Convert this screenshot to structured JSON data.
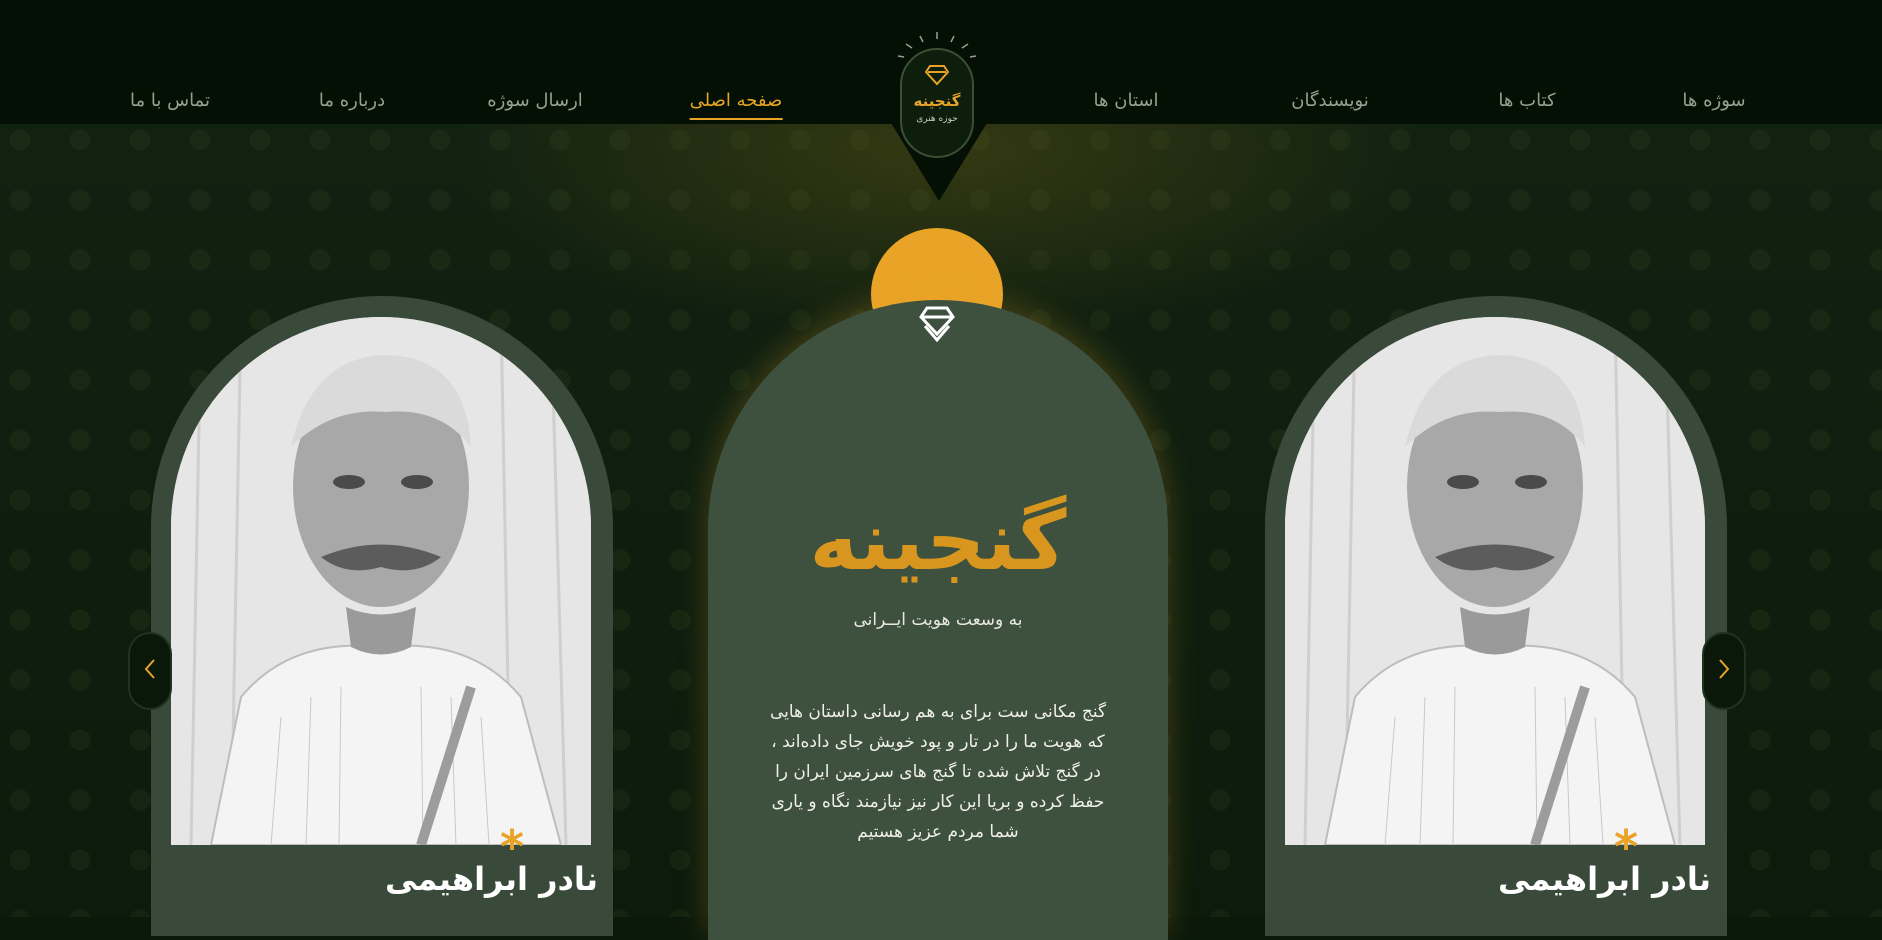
{
  "nav": {
    "items": [
      {
        "label": "سوژه ها",
        "active": false
      },
      {
        "label": "کتاب ها",
        "active": false
      },
      {
        "label": "نویسندگان",
        "active": false
      },
      {
        "label": "استان ها",
        "active": false
      },
      {
        "label": "صفحه اصلی",
        "active": true
      },
      {
        "label": "ارسال سوژه",
        "active": false
      },
      {
        "label": "درباره ما",
        "active": false
      },
      {
        "label": "تماس با ما",
        "active": false
      }
    ]
  },
  "logo": {
    "name": "گنجینه",
    "subtitle": "حوزه هنری"
  },
  "hero": {
    "title": "گنجینه",
    "tagline": "به وسعت هویت ایــرانی",
    "description": "گنج مکانی ست برای به هم رسانی داستان هایی که هویت ما را در تار و پود خویش جای داده‌اند ، در گنج تلاش شده تا گنج های سرزمین ایران را حفظ کرده و بریا این کار نیز نیازمند نگاه و یاری شما مردم عزیز هستیم"
  },
  "cards": [
    {
      "name": "نادر ابراهیمی"
    },
    {
      "name": "نادر ابراهیمی"
    }
  ],
  "colors": {
    "accent": "#e9a427",
    "card": "#3a4a3a",
    "header": "#031003"
  },
  "icons": {
    "prev": "chevron-left-icon",
    "next": "chevron-right-icon",
    "brand": "gem-icon"
  }
}
